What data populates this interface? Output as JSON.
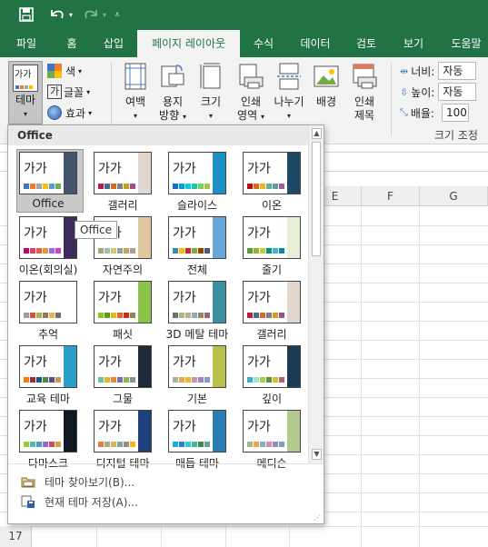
{
  "qat": {
    "save_icon": "save-icon",
    "undo_icon": "undo-icon",
    "redo_icon": "redo-icon",
    "customize_icon": "customize-icon"
  },
  "tabs": [
    {
      "label": "파일"
    },
    {
      "label": "홈"
    },
    {
      "label": "삽입"
    },
    {
      "label": "페이지 레이아웃",
      "active": true
    },
    {
      "label": "수식"
    },
    {
      "label": "데이터"
    },
    {
      "label": "검토"
    },
    {
      "label": "보기"
    },
    {
      "label": "도움말"
    }
  ],
  "ribbon": {
    "themes": {
      "label": "테마",
      "thumb_text": "가가"
    },
    "colors": {
      "label": "색"
    },
    "fonts": {
      "label": "글꼴"
    },
    "effects": {
      "label": "효과"
    },
    "margins": {
      "label": "여백"
    },
    "orientation": {
      "label1": "용지",
      "label2": "방향"
    },
    "size": {
      "label": "크기"
    },
    "print_area": {
      "label1": "인쇄",
      "label2": "영역"
    },
    "breaks": {
      "label": "나누기"
    },
    "background": {
      "label": "배경"
    },
    "print_titles": {
      "label1": "인쇄",
      "label2": "제목"
    },
    "width": {
      "label": "너비:",
      "value": "자동"
    },
    "height": {
      "label": "높이:",
      "value": "자동"
    },
    "scale": {
      "label": "배율:",
      "value": "100"
    },
    "scale_group_label": "크기 조정"
  },
  "sheet": {
    "columns": [
      "E",
      "F",
      "G"
    ],
    "row_label": "17"
  },
  "gallery": {
    "header": "Office",
    "tooltip": "Office",
    "themes": [
      {
        "label": "Office",
        "text": "가가",
        "colors": [
          "#4472c4",
          "#ed7d31",
          "#a5a5a5",
          "#ffc000",
          "#5b9bd5",
          "#70ad47"
        ],
        "accent": "#44546a",
        "selected": true
      },
      {
        "label": "갤러리",
        "text": "가가",
        "colors": [
          "#b71e42",
          "#4a6b8a",
          "#d56b26",
          "#7f7f7f",
          "#c7a11e",
          "#9e4f8b"
        ],
        "accent": "#e2d7ce"
      },
      {
        "label": "슬라이스",
        "text": "가가",
        "colors": [
          "#0f6fc6",
          "#009dd9",
          "#0bd0d9",
          "#10cf9b",
          "#7cca62",
          "#a5c249"
        ],
        "accent": "#1e8fc7"
      },
      {
        "label": "이온",
        "text": "가가",
        "colors": [
          "#b01513",
          "#ea6312",
          "#e6b729",
          "#6aac90",
          "#5f9c9d",
          "#9e5e9b"
        ],
        "accent": "#1c4a63"
      },
      {
        "label": "이온(회의실)",
        "text": "가가",
        "colors": [
          "#b31166",
          "#e33d6f",
          "#e45f3c",
          "#e9943a",
          "#9b6bf2",
          "#d53dd0"
        ],
        "accent": "#3c2a5a"
      },
      {
        "label": "자연주의",
        "text": "가가",
        "colors": [
          "#a9a57c",
          "#9cbebd",
          "#d2cb6c",
          "#95a39d",
          "#c89f5d",
          "#b1a089"
        ],
        "accent": "#e0c8a0"
      },
      {
        "label": "전체",
        "text": "가가",
        "colors": [
          "#3891a7",
          "#feb80a",
          "#c32d2e",
          "#84aa33",
          "#964305",
          "#475a8d"
        ],
        "accent": "#6aa5d8"
      },
      {
        "label": "줄기",
        "text": "가가",
        "colors": [
          "#549e39",
          "#8ab833",
          "#c0cf3a",
          "#029676",
          "#4ab5c4",
          "#0989b1"
        ],
        "accent": "#e7efd6"
      },
      {
        "label": "추억",
        "text": "가가",
        "colors": [
          "#93a299",
          "#cf543f",
          "#b5ae53",
          "#848058",
          "#e8b54d",
          "#786c71"
        ],
        "accent": "#ffffff"
      },
      {
        "label": "패싯",
        "text": "가가",
        "colors": [
          "#90c226",
          "#54a021",
          "#e6b91e",
          "#e76618",
          "#c42f1a",
          "#918655"
        ],
        "accent": "#8bc34a"
      },
      {
        "label": "3D 메탈 테마",
        "text": "가가",
        "colors": [
          "#6f6f74",
          "#a7b789",
          "#beae98",
          "#92a9b9",
          "#9c8265",
          "#8d6974"
        ],
        "accent": "#3a8fa0"
      },
      {
        "label": "갤러리",
        "text": "가가",
        "colors": [
          "#b71e42",
          "#4a6b8a",
          "#d56b26",
          "#7f7f7f",
          "#c7a11e",
          "#9e4f8b"
        ],
        "accent": "#e2d7ce"
      },
      {
        "label": "교육 테마",
        "text": "가가",
        "colors": [
          "#f07f09",
          "#9f2936",
          "#1b587c",
          "#4e8542",
          "#604878",
          "#c19859"
        ],
        "accent": "#2aa0c8"
      },
      {
        "label": "그물",
        "text": "가가",
        "colors": [
          "#6ac1a6",
          "#e5b62c",
          "#e68b2f",
          "#7c6ea8",
          "#86b856",
          "#8f8f8f"
        ],
        "accent": "#1e2a38"
      },
      {
        "label": "기본",
        "text": "가가",
        "colors": [
          "#a5b592",
          "#f3a447",
          "#e7bc29",
          "#d092a7",
          "#9c85c0",
          "#809ec2"
        ],
        "accent": "#b6c04b"
      },
      {
        "label": "깊이",
        "text": "가가",
        "colors": [
          "#41aebd",
          "#97e9d5",
          "#a2cf49",
          "#608f3d",
          "#d3bf2f",
          "#b65c6a"
        ],
        "accent": "#1b3b55"
      },
      {
        "label": "다마스크",
        "text": "가가",
        "colors": [
          "#9ec544",
          "#50bea3",
          "#4a9ccc",
          "#9a66ca",
          "#c54f71",
          "#de9c3c"
        ],
        "accent": "#101820"
      },
      {
        "label": "디지털 테마",
        "text": "가가",
        "colors": [
          "#dd8047",
          "#a5ab81",
          "#d8b25c",
          "#7ba79d",
          "#968c8c",
          "#f7b615"
        ],
        "accent": "#1e3f7a"
      },
      {
        "label": "매듭 테마",
        "text": "가가",
        "colors": [
          "#1cade4",
          "#2683c6",
          "#27ced7",
          "#42ba97",
          "#3e8853",
          "#62a39f"
        ],
        "accent": "#2c7cb4"
      },
      {
        "label": "메디슨",
        "text": "가가",
        "colors": [
          "#a5b592",
          "#f3a447",
          "#7db4be",
          "#d092a7",
          "#9c85c0",
          "#809ec2"
        ],
        "accent": "#b3c98e"
      }
    ],
    "browse_label": "테마 찾아보기(B)...",
    "save_label": "현재 테마 저장(A)..."
  }
}
